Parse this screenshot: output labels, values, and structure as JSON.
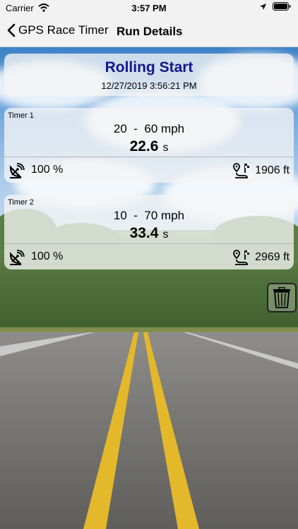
{
  "status_bar": {
    "carrier": "Carrier",
    "time": "3:57 PM"
  },
  "nav": {
    "back_label": "GPS Race Timer",
    "title": "Run Details"
  },
  "run": {
    "title": "Rolling Start",
    "datetime": "12/27/2019 3:56:21 PM",
    "title_color": "#16178a"
  },
  "timers": [
    {
      "label": "Timer 1",
      "range_from": "20",
      "range_sep": "-",
      "range_to": "60",
      "range_unit": "mph",
      "elapsed": "22.6",
      "elapsed_unit": "s",
      "satellite": "100 %",
      "distance": "1906 ft"
    },
    {
      "label": "Timer 2",
      "range_from": "10",
      "range_sep": "-",
      "range_to": "70",
      "range_unit": "mph",
      "elapsed": "33.4",
      "elapsed_unit": "s",
      "satellite": "100 %",
      "distance": "2969 ft"
    }
  ],
  "icons": {
    "back": "chevron-left-icon",
    "wifi": "wifi-icon",
    "location": "location-arrow-icon",
    "battery": "battery-icon",
    "satellite": "satellite-dish-icon",
    "distance": "route-flag-icon",
    "delete": "trash-icon"
  }
}
